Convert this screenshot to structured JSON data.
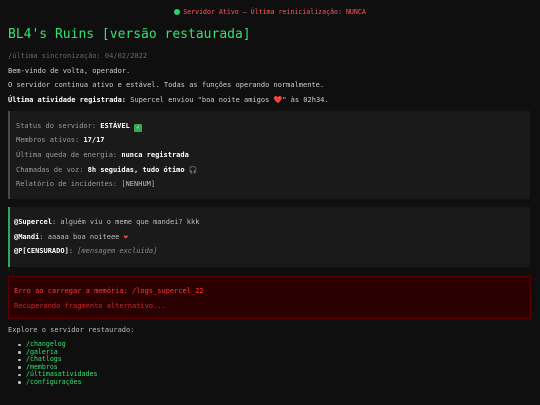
{
  "top_status": {
    "text": "Servidor Ativo — Última reinicialização: NUNCA",
    "indicator_color": "#2bd16b"
  },
  "title": "BL4's Ruins [versão restaurada]",
  "sync": "/última sincronização: 04/02/2022",
  "welcome": "Bem-vindo de volta, operador.",
  "status_message": "O servidor continua ativo e estável. Todas as funções operando normalmente.",
  "last_activity": {
    "label": "Última atividade registrada:",
    "text": "Supercel enviou \"boa noite amigos ❤️\" às 02h34."
  },
  "server_status": {
    "rows": [
      {
        "label": "Status do servidor:",
        "value": "ESTÁVEL",
        "icon": "check-icon"
      },
      {
        "label": "Membros ativos:",
        "value": "17/17"
      },
      {
        "label": "Última queda de energia:",
        "value": "nunca registrada"
      },
      {
        "label": "Chamadas de voz:",
        "value": "8h seguidas, tudo ótimo",
        "icon": "headphones-icon"
      },
      {
        "label": "Relatório de incidentes:",
        "value": "[NENHUM]"
      }
    ]
  },
  "chat": [
    {
      "user": "@Supercel",
      "message": "alguém viu o meme que mandei? kkk"
    },
    {
      "user": "@Mandi",
      "message": "aaaaa boa noiteee",
      "icon": "heart-icon"
    },
    {
      "user": "@P[CENSURADO]",
      "message": "[mensagem excluída]"
    }
  ],
  "error": {
    "line1": "Erro ao carregar a memória: /logs_supercel_22",
    "line2": "Recuperando fragmento alternativo..."
  },
  "explore": {
    "label": "Explore o servidor restaurado:",
    "links": [
      "/changelog",
      "/galeria",
      "/chatlogs",
      "/membros",
      "/últimasatividades",
      "/configurações"
    ]
  },
  "colors": {
    "accent_green": "#35e071",
    "error_red": "#ff3b3b",
    "background": "#0f0f0f"
  }
}
